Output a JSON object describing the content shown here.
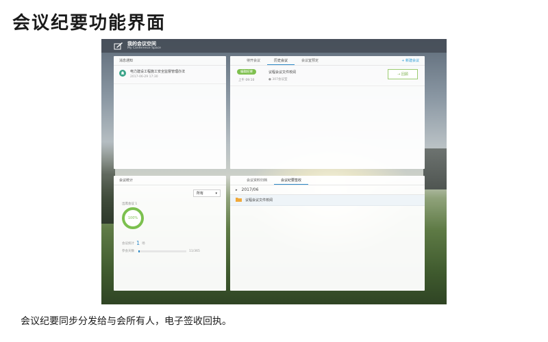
{
  "slide": {
    "title": "会议纪要功能界面",
    "caption": "会议纪要同步分发给与会所有人，电子签收回执。"
  },
  "app": {
    "brand_cn": "我的会议空间",
    "brand_en": "My Conference Space"
  },
  "notices": {
    "heading": "消息通知",
    "items": [
      {
        "text": "电力建设工程施工安全监督管理办法",
        "time": "2017-06-29 17:30"
      }
    ]
  },
  "meetings": {
    "tabs": [
      "待开会议",
      "历史会议",
      "会议室预定"
    ],
    "active_tab": 1,
    "new_button": "+ 新建会议",
    "rows": [
      {
        "badge": "编辑纪要",
        "time": "上午 09:10",
        "title": "议程会议文件校阅",
        "location": "● 307会议室",
        "action": "→ 回顾"
      }
    ]
  },
  "stats": {
    "heading": "会议统计",
    "select_value": "所有",
    "caption": "出席会议 1",
    "ring_value": "100%",
    "count_label": "会议统计",
    "count_value": "1",
    "count_unit": "场",
    "attend_label": "参会天数",
    "attend_value": "11/365",
    "attend_fraction": 0.03
  },
  "archive": {
    "tabs": [
      "会议资料归档",
      "会议纪要签收"
    ],
    "active_tab": 1,
    "period": "2017/06",
    "folders": [
      {
        "name": "议程会议文件校阅"
      }
    ]
  },
  "colors": {
    "accent": "#2b88c7",
    "green": "#7cc04f",
    "notice_icon": "#3ba48a"
  }
}
